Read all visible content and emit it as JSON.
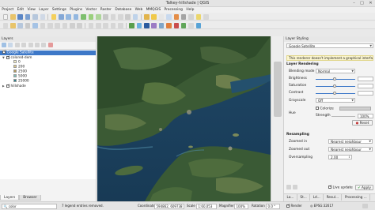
{
  "window": {
    "title": "Talkey-hillshade | QGIS",
    "controls": [
      "minimize-icon",
      "maximize-icon",
      "close-icon"
    ]
  },
  "menu": [
    "Project",
    "Edit",
    "View",
    "Layer",
    "Settings",
    "Plugins",
    "Vector",
    "Raster",
    "Database",
    "Web",
    "MMQGIS",
    "Processing",
    "Help"
  ],
  "layers_panel": {
    "title": "Layers",
    "items": [
      {
        "label": "Google Satellite",
        "checked": true,
        "selected": true,
        "kind": "raster"
      },
      {
        "label": "colored-dem",
        "checked": true,
        "selected": false,
        "kind": "group"
      },
      {
        "label": "0",
        "color": "#f5f0c6"
      },
      {
        "label": "200",
        "color": "#dcc789"
      },
      {
        "label": "2500",
        "color": "#b49a5b"
      },
      {
        "label": "5000",
        "color": "#7ebfb9"
      },
      {
        "label": "25000",
        "color": "#2f7f8a"
      },
      {
        "label": "hillshade",
        "checked": true,
        "selected": false,
        "kind": "raster"
      }
    ],
    "tabs": [
      "Layers",
      "Browser"
    ]
  },
  "styling_panel": {
    "title": "Layer Styling",
    "layer": "Google Satellite",
    "info": "This renderer doesn't implement a graphical interface.",
    "layer_rendering": "Layer Rendering",
    "blending_label": "Blending mode",
    "blending_value": "Normal",
    "brightness": "Brightness",
    "brightness_level": 0.5,
    "saturation": "Saturation",
    "saturation_level": 0.5,
    "contrast": "Contrast",
    "contrast_level": 0.5,
    "grayscale": "Grayscale",
    "grayscale_value": "Off",
    "colorize": "Colorize",
    "strength": "Strength",
    "strength_value": "100%",
    "hue": "Hue",
    "reset": "Reset",
    "resampling": "Resampling",
    "zoomed_in_label": "Zoomed in",
    "zoomed_in_value": "Nearest neighbour",
    "zoomed_out_label": "Zoomed out",
    "zoomed_out_value": "Nearest neighbour",
    "oversampling_label": "Oversampling",
    "oversampling_value": "2.00",
    "live_update": "Live update",
    "live_update_checked": true,
    "apply": "Apply",
    "bottom_tabs": [
      "La...",
      "St...",
      "Ld...",
      "Resul...",
      "Processing ...",
      "Sea..."
    ]
  },
  "statusbar": {
    "search_value": "color",
    "search_hint": "7 legend entries removed.",
    "coordinate_label": "Coordinate",
    "coordinate_value": "594862, 609738",
    "scale_label": "Scale",
    "scale_value": "1:60,053",
    "magnifier_label": "Magnifier",
    "magnifier_value": "100%",
    "rotation_label": "Rotation",
    "rotation_value": "0.0 °",
    "render_label": "Render",
    "crs_value": "EPSG:32617"
  },
  "colors": {
    "selection": "#3d78c8",
    "accent": "#3d78c8"
  }
}
